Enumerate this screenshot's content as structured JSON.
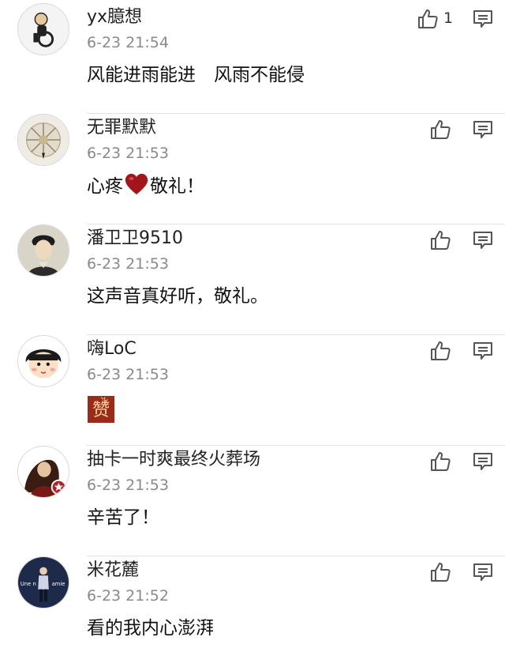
{
  "comments": [
    {
      "username": "yx臆想",
      "timestamp": "6-23 21:54",
      "content": "风能进雨能进　风雨不能侵",
      "like_count": "1",
      "avatar_icon": "wheelchair-figure-icon"
    },
    {
      "username": "无罪默默",
      "timestamp": "6-23 21:53",
      "content_before": "心疼",
      "content_after": "敬礼！",
      "inline_emoji": "heart-emoji",
      "like_count": "",
      "avatar_icon": "compass-dial-icon"
    },
    {
      "username": "潘卫卫9510",
      "timestamp": "6-23 21:53",
      "content": "这声音真好听，敬礼。",
      "like_count": "",
      "avatar_icon": "costume-portrait-icon"
    },
    {
      "username": "嗨LoC",
      "timestamp": "6-23 21:53",
      "sticker": "赞",
      "like_count": "",
      "avatar_icon": "cartoon-girl-icon"
    },
    {
      "username": "抽卡一时爽最终火葬场",
      "timestamp": "6-23 21:53",
      "content": "辛苦了！",
      "like_count": "",
      "avatar_icon": "anime-figure-icon"
    },
    {
      "username": "米花麓",
      "timestamp": "6-23 21:52",
      "content": "看的我内心澎湃",
      "like_count": "",
      "avatar_icon": "standing-figure-icon",
      "avatar_text_left": "Une n",
      "avatar_text_right": "amie"
    }
  ],
  "colors": {
    "username": "#222222",
    "timestamp": "#8a8a8a",
    "divider": "#e2e2e2",
    "icon": "#555555",
    "heart": "#a3141b",
    "sticker_bg": "#9b2a1a",
    "sticker_text": "#f3d9a2"
  }
}
